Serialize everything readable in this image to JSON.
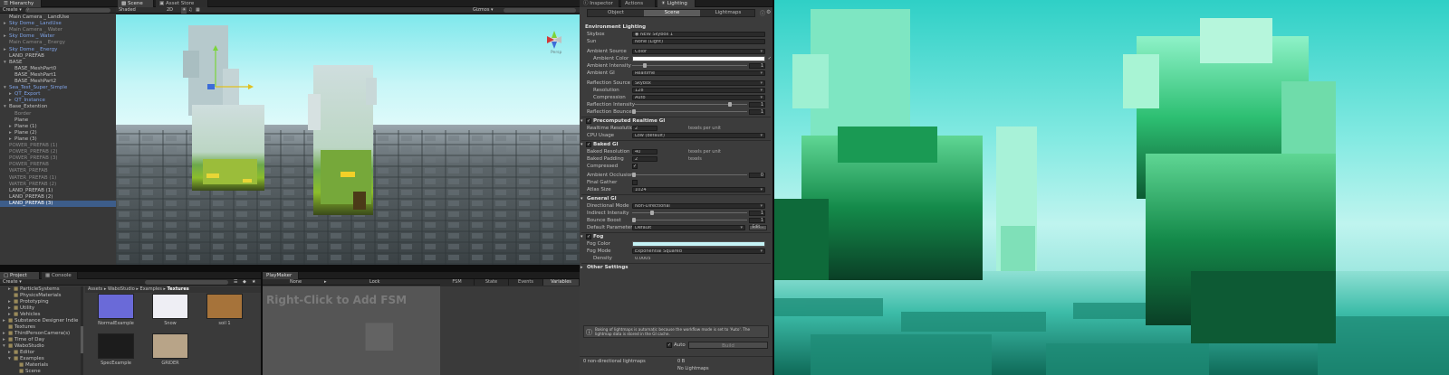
{
  "hierarchy": {
    "tab": "Hierarchy",
    "create_label": "Create ▾",
    "search_placeholder": "All",
    "items": [
      {
        "label": "Main Camera _ LandUse",
        "style": "normal",
        "indent": 0,
        "arrow": ""
      },
      {
        "label": "Sky Dome _ LandUse",
        "style": "blue",
        "indent": 0,
        "arrow": "▸"
      },
      {
        "label": "Main Camera _ Water",
        "style": "dim",
        "indent": 0,
        "arrow": ""
      },
      {
        "label": "Sky Dome _ Water",
        "style": "blue",
        "indent": 0,
        "arrow": "▸"
      },
      {
        "label": "Main Camera _ Energy",
        "style": "dim",
        "indent": 0,
        "arrow": ""
      },
      {
        "label": "Sky Dome _ Energy",
        "style": "blue",
        "indent": 0,
        "arrow": "▸"
      },
      {
        "label": "LAND_PREFAB",
        "style": "normal",
        "indent": 0,
        "arrow": ""
      },
      {
        "label": "BASE",
        "style": "normal",
        "indent": 0,
        "arrow": "▾"
      },
      {
        "label": "BASE_MeshPart0",
        "style": "normal",
        "indent": 1,
        "arrow": ""
      },
      {
        "label": "BASE_MeshPart1",
        "style": "normal",
        "indent": 1,
        "arrow": ""
      },
      {
        "label": "BASE_MeshPart2",
        "style": "normal",
        "indent": 1,
        "arrow": ""
      },
      {
        "label": "Sea_Test_Super_Simple",
        "style": "blue",
        "indent": 0,
        "arrow": "▾"
      },
      {
        "label": "QT_Export",
        "style": "blue",
        "indent": 1,
        "arrow": "▸"
      },
      {
        "label": "QT_Instance",
        "style": "blue",
        "indent": 1,
        "arrow": "▸"
      },
      {
        "label": "Base_Extention",
        "style": "normal",
        "indent": 0,
        "arrow": "▾"
      },
      {
        "label": "Border",
        "style": "dim",
        "indent": 1,
        "arrow": ""
      },
      {
        "label": "Plane",
        "style": "normal",
        "indent": 1,
        "arrow": ""
      },
      {
        "label": "Plane (1)",
        "style": "normal",
        "indent": 1,
        "arrow": "▸"
      },
      {
        "label": "Plane (2)",
        "style": "normal",
        "indent": 1,
        "arrow": "▸"
      },
      {
        "label": "Plane (3)",
        "style": "normal",
        "indent": 1,
        "arrow": "▸"
      },
      {
        "label": "POWER_PREFAB (1)",
        "style": "dim",
        "indent": 0,
        "arrow": ""
      },
      {
        "label": "POWER_PREFAB (2)",
        "style": "dim",
        "indent": 0,
        "arrow": ""
      },
      {
        "label": "POWER_PREFAB (3)",
        "style": "dim",
        "indent": 0,
        "arrow": ""
      },
      {
        "label": "POWER_PREFAB",
        "style": "dim",
        "indent": 0,
        "arrow": ""
      },
      {
        "label": "WATER_PREFAB",
        "style": "dim",
        "indent": 0,
        "arrow": ""
      },
      {
        "label": "WATER_PREFAB (1)",
        "style": "dim",
        "indent": 0,
        "arrow": ""
      },
      {
        "label": "WATER_PREFAB (2)",
        "style": "dim",
        "indent": 0,
        "arrow": ""
      },
      {
        "label": "LAND_PREFAB (1)",
        "style": "normal",
        "indent": 0,
        "arrow": ""
      },
      {
        "label": "LAND_PREFAB (2)",
        "style": "normal",
        "indent": 0,
        "arrow": ""
      },
      {
        "label": "LAND_PREFAB (3)",
        "style": "sel",
        "indent": 0,
        "arrow": ""
      }
    ]
  },
  "scene": {
    "tabs": [
      "Scene",
      "Asset Store"
    ],
    "shading": "Shaded",
    "mode_2d": "2D",
    "gizmos": "Gizmos ▾",
    "search_placeholder": "All",
    "gizmo_label": "Persp"
  },
  "project": {
    "tabs": [
      "Project",
      "Console"
    ],
    "create_label": "Create ▾",
    "folders": [
      {
        "label": "ParticleSystems",
        "indent": 1,
        "arrow": "▸"
      },
      {
        "label": "PhysicsMaterials",
        "indent": 1,
        "arrow": ""
      },
      {
        "label": "Prototyping",
        "indent": 1,
        "arrow": "▸"
      },
      {
        "label": "Utility",
        "indent": 1,
        "arrow": "▸"
      },
      {
        "label": "Vehicles",
        "indent": 1,
        "arrow": "▸"
      },
      {
        "label": "Substance Designer Indie",
        "indent": 0,
        "arrow": "▸"
      },
      {
        "label": "Textures",
        "indent": 0,
        "arrow": ""
      },
      {
        "label": "ThirdPersonCamera(s)",
        "indent": 0,
        "arrow": "▸"
      },
      {
        "label": "Time of Day",
        "indent": 0,
        "arrow": "▸"
      },
      {
        "label": "WaboStudio",
        "indent": 0,
        "arrow": "▾"
      },
      {
        "label": "Editor",
        "indent": 1,
        "arrow": "▸"
      },
      {
        "label": "Examples",
        "indent": 1,
        "arrow": "▾"
      },
      {
        "label": "Materials",
        "indent": 2,
        "arrow": ""
      },
      {
        "label": "Scene",
        "indent": 2,
        "arrow": ""
      }
    ],
    "breadcrumb": [
      "Assets",
      "WaboStudio",
      "Examples",
      "Textures"
    ],
    "thumbnails": [
      {
        "label": "NormalExample",
        "color": "#6a6ad8"
      },
      {
        "label": "Snow",
        "color": "#eeeef4"
      },
      {
        "label": "soil 1",
        "color": "#a6733a"
      },
      {
        "label": "SpecExample",
        "color": "#1c1c1c"
      },
      {
        "label": "GRIDER",
        "color": "#b8a488"
      }
    ]
  },
  "playmaker": {
    "tab": "PlayMaker",
    "fsm_dropdown": "None",
    "lock_label": "Lock",
    "hint": "Right-Click to Add FSM",
    "tabs": [
      "FSM",
      "State",
      "Events",
      "Variables"
    ]
  },
  "inspector": {
    "tabs": [
      "Inspector",
      "Actions",
      "Lighting"
    ],
    "subtabs": [
      "Object",
      "Scene",
      "Lightmaps"
    ],
    "environment_title": "Environment Lighting",
    "skybox_label": "Skybox",
    "skybox_value": "◉ NEW Skybox 1",
    "sun_label": "Sun",
    "sun_value": "None (Light)",
    "ambient_source_label": "Ambient Source",
    "ambient_source_value": "Color",
    "ambient_color_label": "Ambient Color",
    "ambient_intensity_label": "Ambient Intensity",
    "ambient_intensity_value": "1",
    "ambient_gi_label": "Ambient GI",
    "ambient_gi_value": "Realtime",
    "reflection_source_label": "Reflection Source",
    "reflection_source_value": "Skybox",
    "resolution_label": "Resolution",
    "resolution_value": "128",
    "compression_label": "Compression",
    "compression_value": "Auto",
    "reflection_intensity_label": "Reflection Intensity",
    "reflection_intensity_value": "1",
    "reflection_bounces_label": "Reflection Bounces",
    "reflection_bounces_value": "1",
    "precomputed_title": "Precomputed Realtime GI",
    "realtime_res_label": "Realtime Resolution",
    "realtime_res_value": "2",
    "texels_unit": "texels per unit",
    "cpu_usage_label": "CPU Usage",
    "cpu_usage_value": "Low (default)",
    "baked_title": "Baked GI",
    "baked_res_label": "Baked Resolution",
    "baked_res_value": "40",
    "baked_padding_label": "Baked Padding",
    "baked_padding_value": "2",
    "texels_short": "texels",
    "compressed_label": "Compressed",
    "ambient_occlusion_label": "Ambient Occlusion",
    "ambient_occlusion_value": "0",
    "final_gather_label": "Final Gather",
    "atlas_size_label": "Atlas Size",
    "atlas_size_value": "1024",
    "general_title": "General GI",
    "directional_mode_label": "Directional Mode",
    "directional_mode_value": "Non-Directional",
    "indirect_intensity_label": "Indirect Intensity",
    "indirect_intensity_value": "1",
    "bounce_boost_label": "Bounce Boost",
    "bounce_boost_value": "1",
    "default_params_label": "Default Parameters",
    "default_params_value": "Default",
    "edit_label": "Edit...",
    "fog_title": "Fog",
    "fog_color_label": "Fog Color",
    "fog_mode_label": "Fog Mode",
    "fog_mode_value": "Exponential Squared",
    "density_label": "Density",
    "density_value": "0.0005",
    "other_settings": "Other Settings",
    "info_text": "Baking of lightmaps is automatic because the workflow mode is set to 'Auto'. The lightmap data is stored in the GI cache.",
    "auto_label": "Auto",
    "build_label": "Build",
    "stats_left": "0 non-directional lightmaps",
    "stats_right_1": "0 B",
    "stats_right_2": "No Lightmaps",
    "colors": {
      "ambient_color": "#ffffff",
      "fog_color": "#c5f3f6"
    }
  }
}
